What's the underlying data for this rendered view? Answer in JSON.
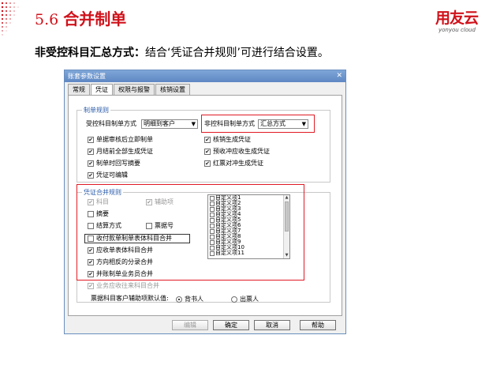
{
  "slide": {
    "section_number": "5.6",
    "section_title": "合并制单",
    "logo_cn": "用友云",
    "logo_en": "yonyou cloud",
    "subtitle_bold": "非受控科目汇总方式：",
    "subtitle_rest": "结合‘凭证合并规则’可进行结合设置。"
  },
  "dialog": {
    "title": "账套参数设置",
    "close_glyph": "✕",
    "tabs": [
      "常规",
      "凭证",
      "权限与报警",
      "核销设置"
    ],
    "active_tab": 1,
    "rules_group": {
      "title": "制单规则",
      "controlled_label": "受控科目制单方式",
      "controlled_value": "明细到客户",
      "uncontrolled_label": "非控科目制单方式",
      "uncontrolled_value": "汇总方式",
      "left_checks": [
        {
          "label": "单据审核后立即制单",
          "checked": true
        },
        {
          "label": "月结前全部生成凭证",
          "checked": true
        },
        {
          "label": "制单时回写摘要",
          "checked": true
        },
        {
          "label": "凭证可编辑",
          "checked": true
        }
      ],
      "right_checks": [
        {
          "label": "核销生成凭证",
          "checked": true
        },
        {
          "label": "预收冲应收生成凭证",
          "checked": true
        },
        {
          "label": "红票对冲生成凭证",
          "checked": true
        }
      ]
    },
    "merge_group": {
      "title": "凭证合并规则",
      "subject_label": "科目",
      "aux_label": "辅助项",
      "summary_label": "摘要",
      "settlement_label": "结算方式",
      "bill_no_label": "票据号",
      "list_checks": [
        {
          "label": "收付款单制单表体科目合并",
          "checked": false
        },
        {
          "label": "应收单表体科目合并",
          "checked": true
        },
        {
          "label": "方向相反的分录合并",
          "checked": true
        },
        {
          "label": "并账制单业务员合并",
          "checked": true
        },
        {
          "label": "业务应收往来科目合并",
          "checked": true
        }
      ],
      "custom_items": [
        "自定义项1",
        "自定义项2",
        "自定义项3",
        "自定义项4",
        "自定义项5",
        "自定义项6",
        "自定义项7",
        "自定义项8",
        "自定义项9",
        "自定义项10",
        "自定义项11"
      ]
    },
    "default_aux": {
      "label": "票据科目客户辅助项默认值:",
      "option1": "背书人",
      "option2": "出票人",
      "selected": "背书人"
    },
    "buttons": {
      "edit": "编辑",
      "ok": "确定",
      "cancel": "取消",
      "help": "帮助"
    },
    "check_glyph": "✔"
  }
}
